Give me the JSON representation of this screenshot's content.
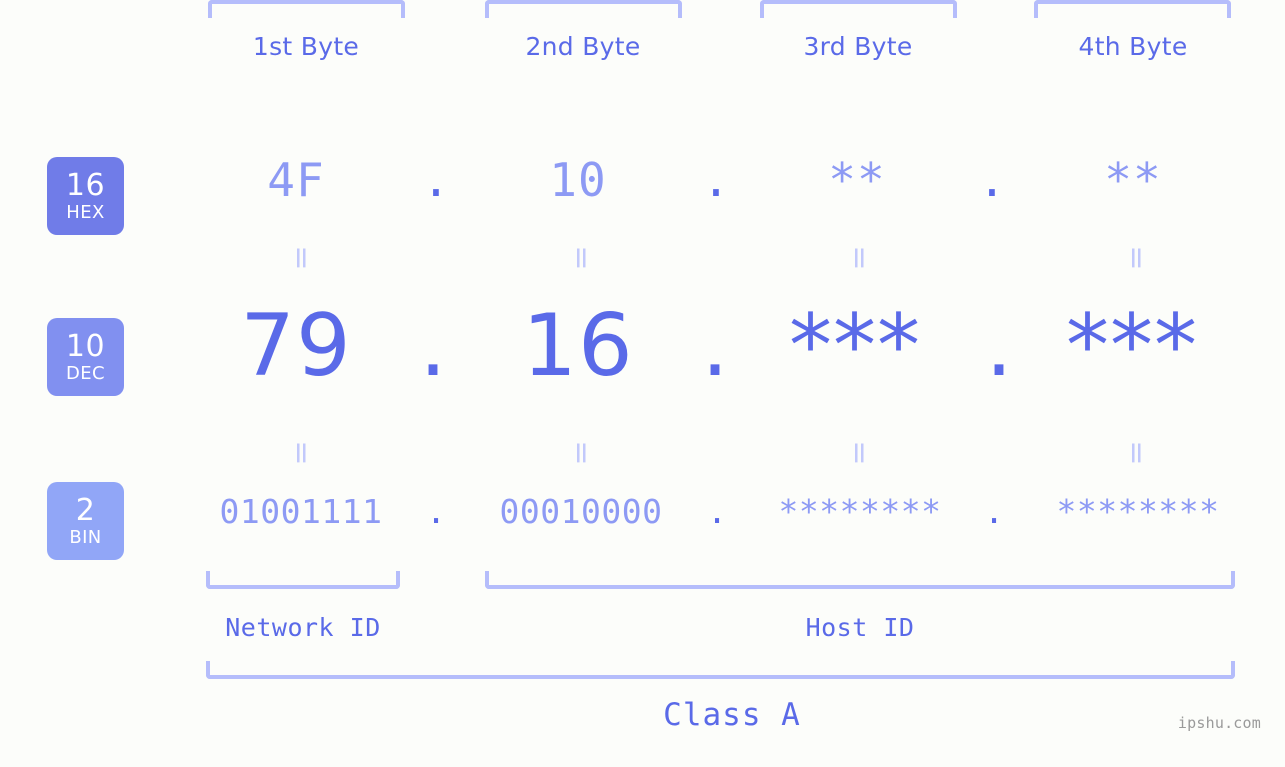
{
  "meta": {
    "background_color": "#fcfdfa",
    "accent_strong": "#5a6ae8",
    "accent_light": "#8d9af4",
    "accent_pale": "#b5bdfb"
  },
  "byte_headers": [
    {
      "label": "1st Byte"
    },
    {
      "label": "2nd Byte"
    },
    {
      "label": "3rd Byte"
    },
    {
      "label": "4th Byte"
    }
  ],
  "rows": [
    {
      "key": "hex",
      "badge": {
        "number": "16",
        "label": "HEX",
        "color": "#707ce8"
      },
      "values": [
        "4F",
        "10",
        "**",
        "**"
      ],
      "separator": "."
    },
    {
      "key": "dec",
      "badge": {
        "number": "10",
        "label": "DEC",
        "color": "#8190f0"
      },
      "values": [
        "79",
        "16",
        "***",
        "***"
      ],
      "separator": "."
    },
    {
      "key": "bin",
      "badge": {
        "number": "2",
        "label": "BIN",
        "color": "#91a6f7"
      },
      "values": [
        "01001111",
        "00010000",
        "********",
        "********"
      ],
      "separator": "."
    }
  ],
  "equality_marks": {
    "symbol": "=",
    "count_per_gap": 4,
    "gaps": 2
  },
  "segments": {
    "network_id": "Network ID",
    "host_id": "Host ID"
  },
  "class": {
    "label": "Class A"
  },
  "watermark": {
    "text": "ipshu.com"
  }
}
